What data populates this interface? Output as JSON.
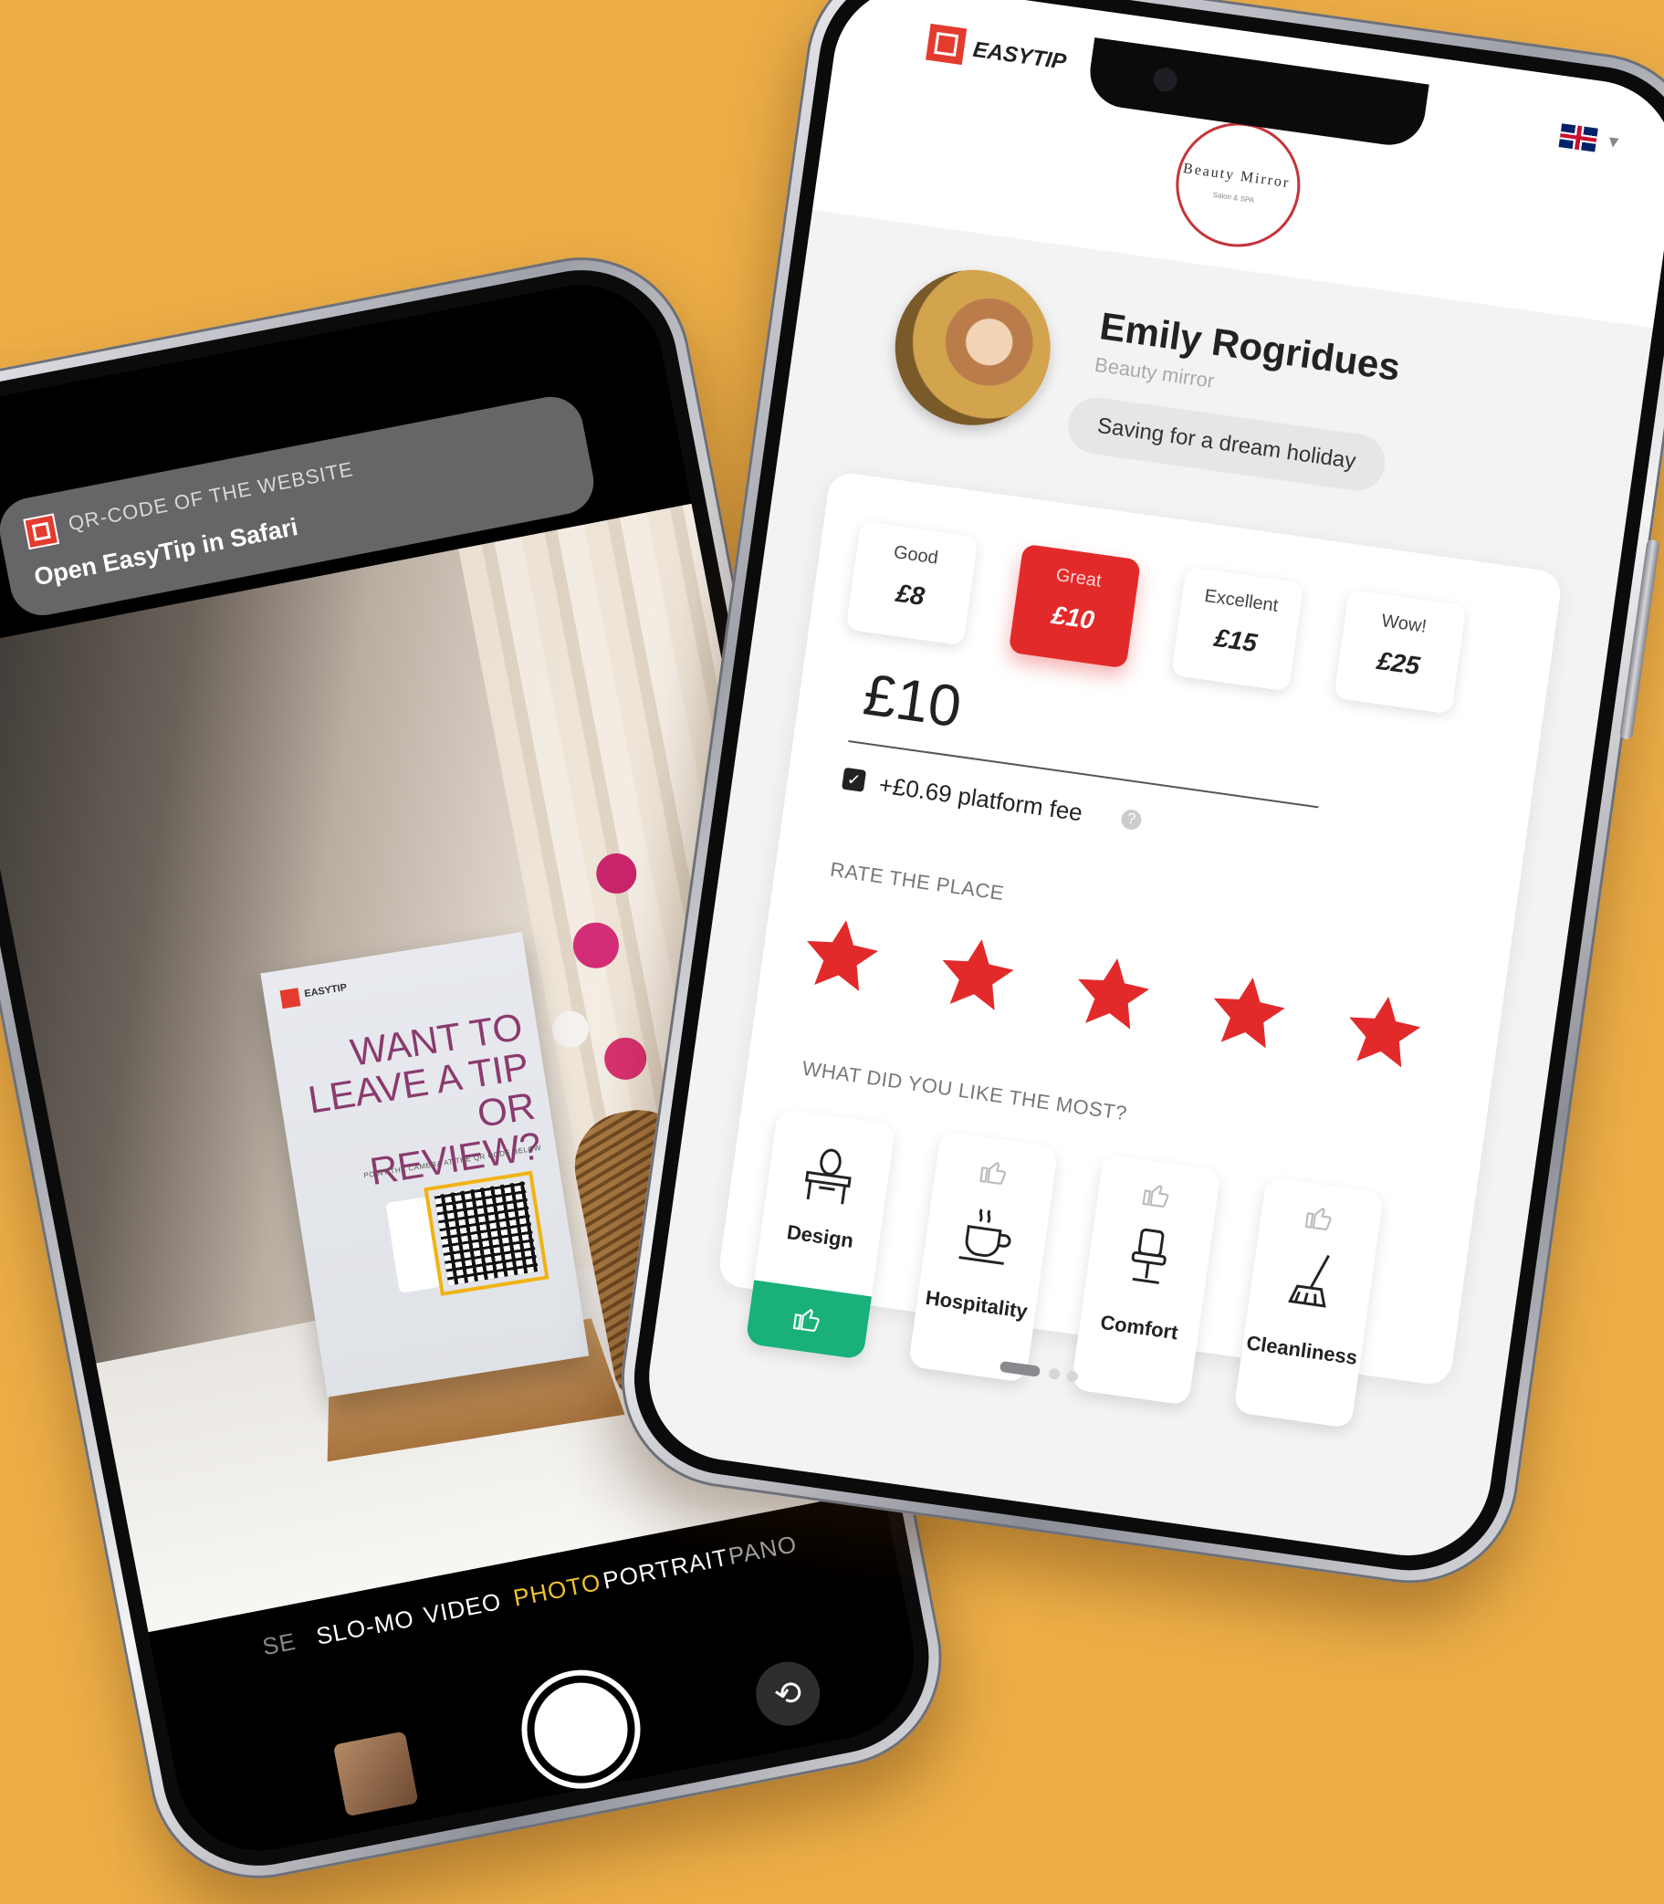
{
  "colors": {
    "background": "#EDAE47",
    "accent_red": "#E32A2A",
    "accent_green": "#1AB07A"
  },
  "camera_phone": {
    "notification": {
      "label": "QR-CODE OF THE WEBSITE",
      "title": "Open EasyTip in Safari"
    },
    "card": {
      "brand": "EASYTIP",
      "headline": "WANT TO LEAVE A TIP OR REVIEW?",
      "subtext": "POINT THE CAMERA AT THE QR CODE BELOW"
    },
    "modes": [
      "SE",
      "SLO-MO",
      "VIDEO",
      "PHOTO",
      "PORTRAIT",
      "PANO"
    ],
    "active_mode": "PHOTO"
  },
  "app_phone": {
    "header": {
      "app_name": "EASYTIP",
      "venue_logo": "Beauty Mirror",
      "venue_logo_sub": "Salon & SPA"
    },
    "profile": {
      "name": "Emily Rogridues",
      "role": "Beauty mirror",
      "goal": "Saving for a dream holiday"
    },
    "tip_options": [
      {
        "label": "Good",
        "amount": "£8",
        "selected": false
      },
      {
        "label": "Great",
        "amount": "£10",
        "selected": true
      },
      {
        "label": "Excellent",
        "amount": "£15",
        "selected": false
      },
      {
        "label": "Wow!",
        "amount": "£25",
        "selected": false
      }
    ],
    "amount": "£10",
    "fee": {
      "checked": true,
      "text": "+£0.69 platform fee",
      "help": "?"
    },
    "rating": {
      "title": "RATE THE PLACE",
      "value": 5,
      "max": 5
    },
    "likes": {
      "title": "WHAT DID YOU LIKE THE MOST?",
      "items": [
        {
          "label": "Design",
          "icon": "vanity-mirror-icon",
          "selected": true
        },
        {
          "label": "Hospitality",
          "icon": "coffee-cup-icon",
          "selected": false
        },
        {
          "label": "Comfort",
          "icon": "barber-chair-icon",
          "selected": false
        },
        {
          "label": "Cleanliness",
          "icon": "mop-icon",
          "selected": false
        }
      ]
    },
    "pager": {
      "pages": 3,
      "current": 1
    }
  }
}
